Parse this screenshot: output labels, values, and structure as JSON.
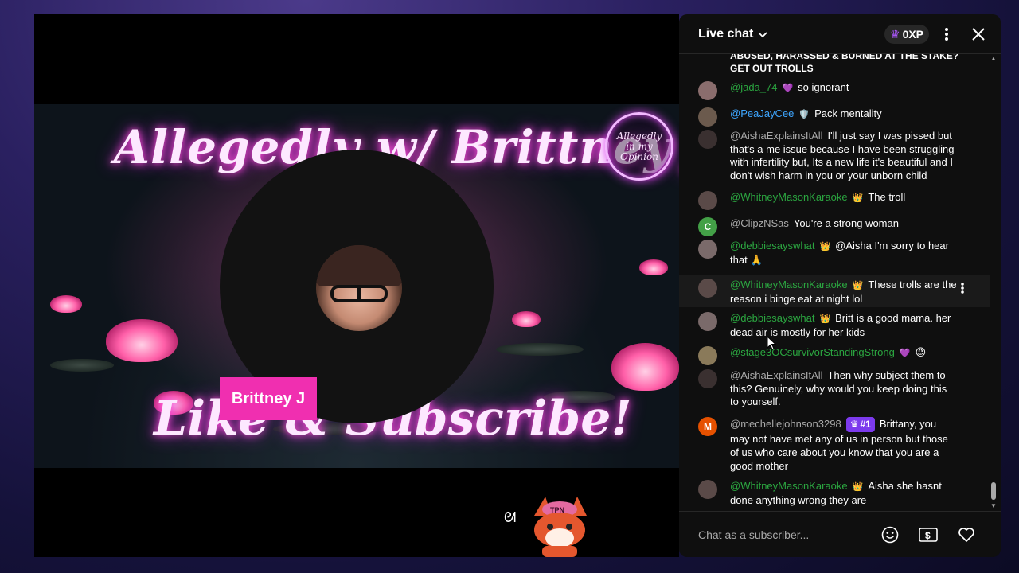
{
  "video": {
    "banner_title": "Allegedly w/ Brittney J",
    "banner_cta": "Like & Subscribe!",
    "logo_text": "Allegedly in my Opinion",
    "name_tag": "Brittney J",
    "mascot_hat": "TPN"
  },
  "chat": {
    "header": {
      "title": "Live chat",
      "xp": "0XP"
    },
    "truncated_top": "ABUSED, HARASSED & BURNED AT THE STAKE? GET OUT TROLLS",
    "messages": [
      {
        "author": "@jada_74",
        "badge": "💜",
        "text": "so ignorant",
        "avatar_color": "#8a6d6d",
        "avatar_letter": ""
      },
      {
        "author": "@PeaJayCee",
        "badge": "🛡️",
        "text": "Pack mentality",
        "avatar_color": "#6b5a4d",
        "avatar_letter": ""
      },
      {
        "author": "@AishaExplainsItAll",
        "badge": "",
        "text": "I'll just say I was pissed but that's a me issue because I have been struggling with infertility but, Its a new life it's beautiful and I don't wish harm in you or your unborn child",
        "avatar_color": "#3a3030",
        "avatar_letter": ""
      },
      {
        "author": "@WhitneyMasonKaraoke",
        "badge": "👑",
        "text": "The troll",
        "avatar_color": "#5a4a48",
        "avatar_letter": ""
      },
      {
        "author": "@ClipzNSas",
        "badge": "",
        "text": "You're a strong woman",
        "avatar_color": "#43a047",
        "avatar_letter": "C"
      },
      {
        "author": "@debbiesayswhat",
        "badge": "👑",
        "text": "@Aisha I'm sorry to hear that 🙏",
        "avatar_color": "#7a6a6a",
        "avatar_letter": ""
      },
      {
        "author": "@WhitneyMasonKaraoke",
        "badge": "👑",
        "text": "These trolls are the reason i binge eat at night lol",
        "avatar_color": "#5a4a48",
        "avatar_letter": ""
      },
      {
        "author": "@debbiesayswhat",
        "badge": "👑",
        "text": "Britt is a good mama. her dead air is mostly for her kids",
        "avatar_color": "#7a6a6a",
        "avatar_letter": ""
      },
      {
        "author": "@stage3OCsurvivorStandingStrong",
        "badge": "💜",
        "text": "😡",
        "avatar_color": "#8a7a5a",
        "avatar_letter": ""
      },
      {
        "author": "@AishaExplainsItAll",
        "badge": "",
        "text": "Then why subject them to this? Genuinely, why would you keep doing this to yourself.",
        "avatar_color": "#3a3030",
        "avatar_letter": ""
      },
      {
        "author": "@mechellejohnson3298",
        "badge": "#1",
        "text": "Brittany, you may not have met any of us in person but those of us who care about you know that you are a good mother",
        "avatar_color": "#e65100",
        "avatar_letter": "M"
      },
      {
        "author": "@WhitneyMasonKaraoke",
        "badge": "👑",
        "text": "Aisha she hasnt done anything wrong they are",
        "avatar_color": "#5a4a48",
        "avatar_letter": ""
      }
    ],
    "input_placeholder": "Chat as a subscriber..."
  },
  "colors": {
    "author_green": "#2ba640",
    "author_gray": "#aaaaaa",
    "name_tag": "#f02fb0",
    "chat_bg": "#0f0f0f",
    "rank_badge": "#7c3aed"
  }
}
